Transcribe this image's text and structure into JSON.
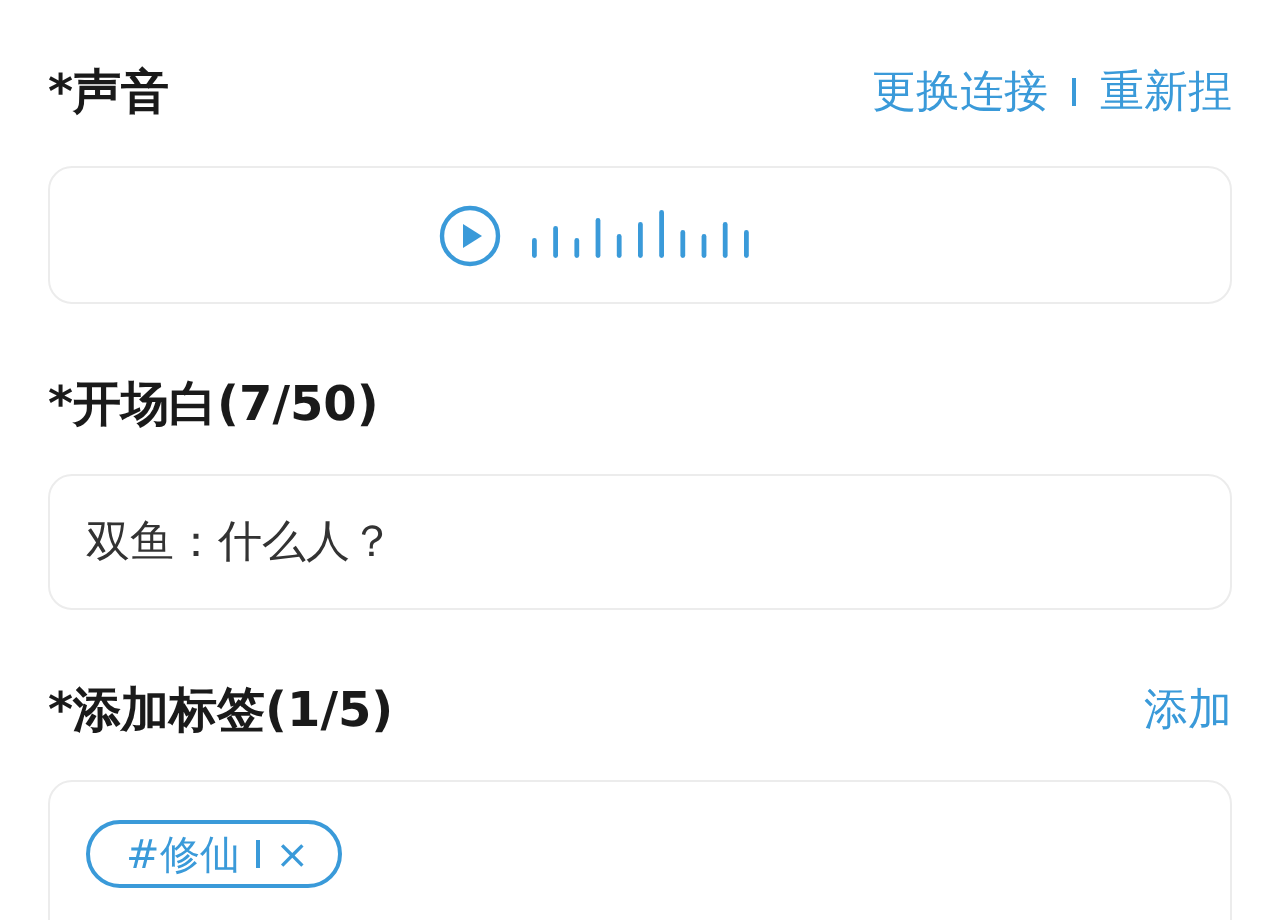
{
  "voice": {
    "title": "*声音",
    "actions": [
      {
        "label": "更换连接"
      },
      {
        "label": "重新捏"
      }
    ]
  },
  "opening": {
    "title": "*开场白(7/50)",
    "value": "双鱼：什么人？"
  },
  "tags": {
    "title": "*添加标签(1/5)",
    "add_label": "添加",
    "items": [
      {
        "label": "#修仙",
        "remove": "×"
      }
    ]
  }
}
